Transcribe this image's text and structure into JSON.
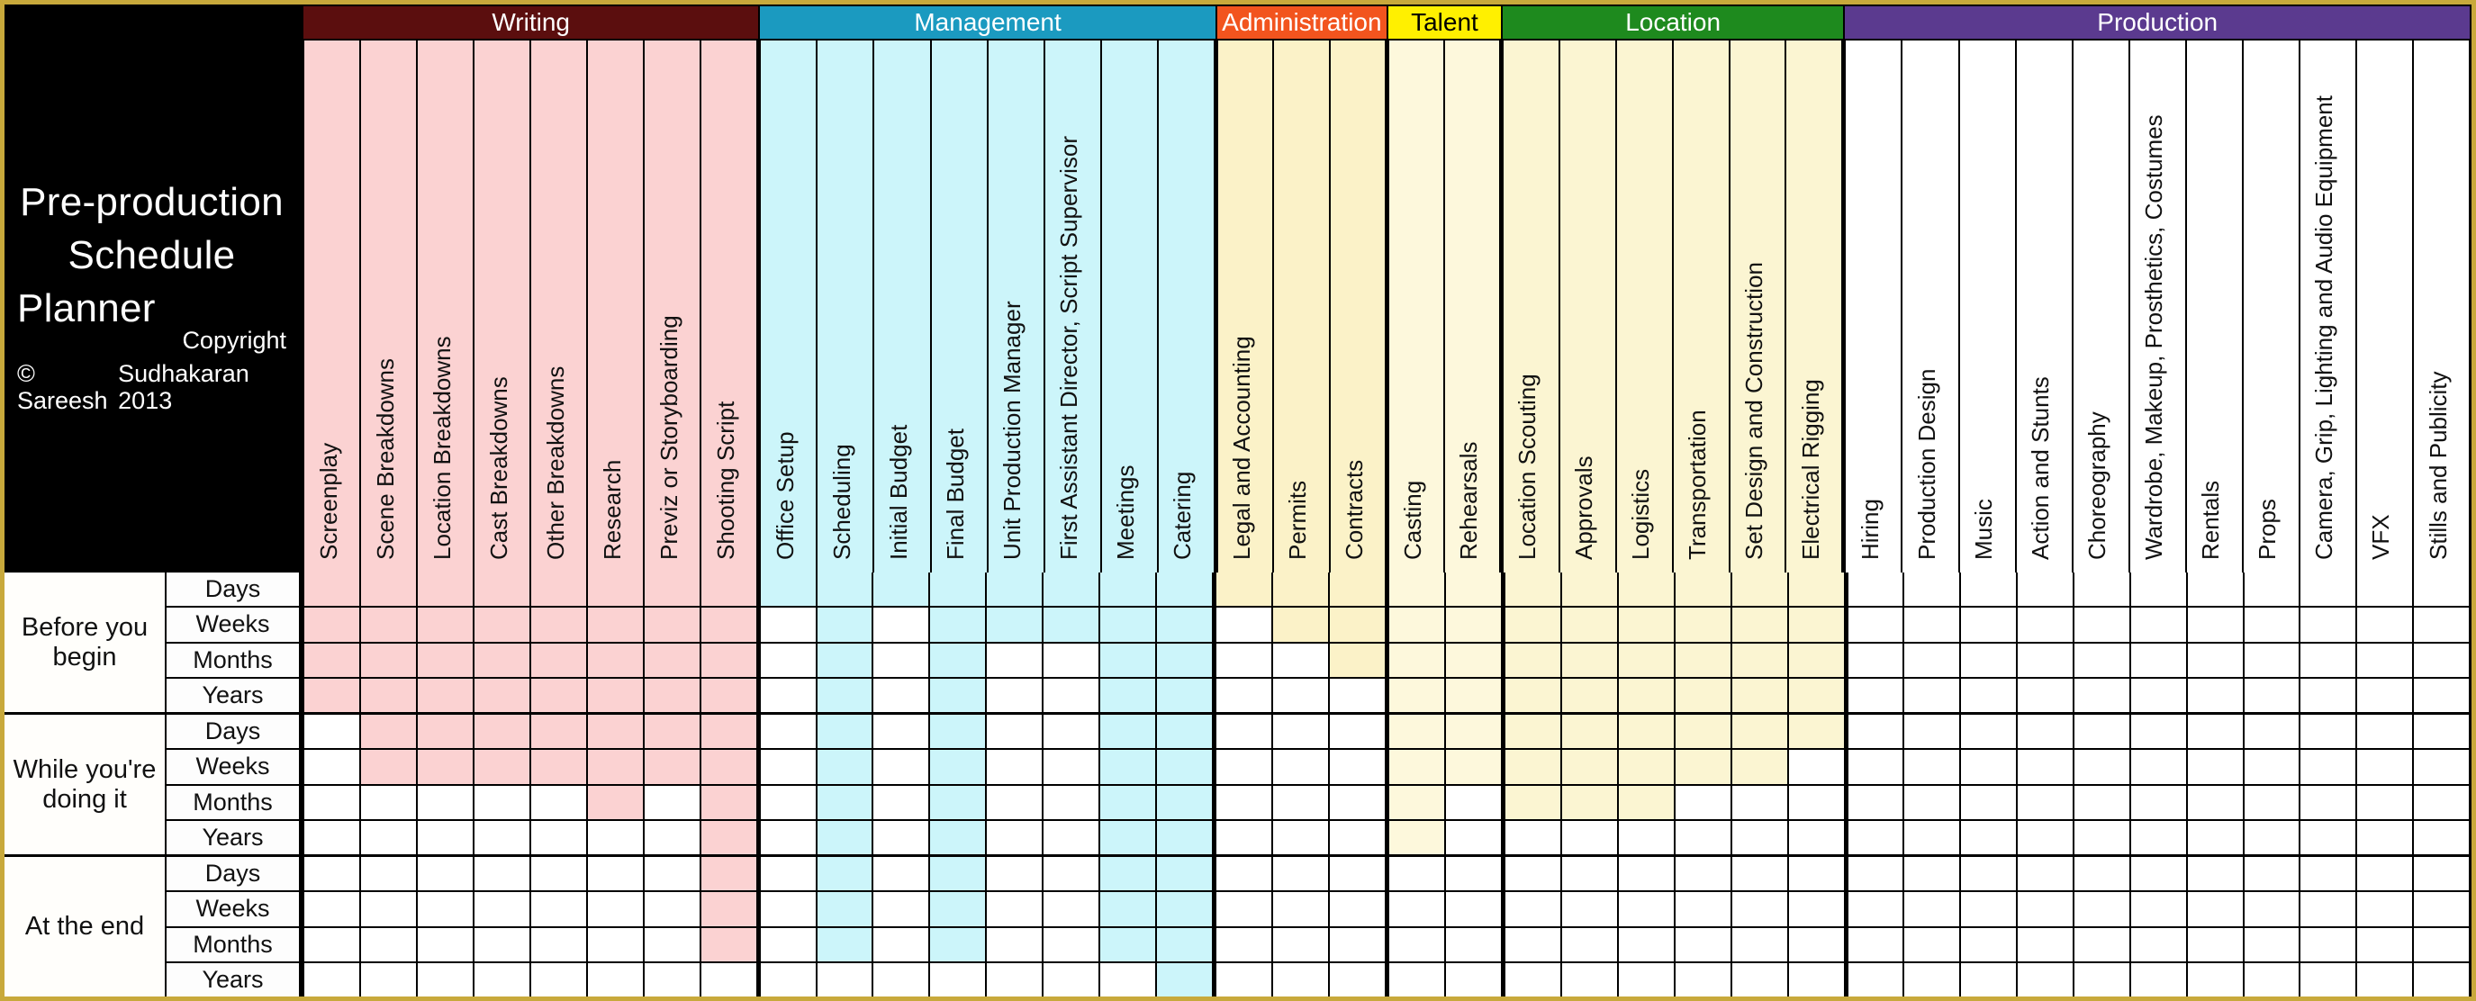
{
  "title": {
    "line1": "Pre-production",
    "line2": "Schedule",
    "line3": "Planner",
    "copyright_label": "Copyright",
    "copyright_owner": "© Sareesh",
    "copyright_rest": "Sudhakaran 2013"
  },
  "colors": {
    "sheet_border": "#C8A93B",
    "writing_header_bg": "#5B0E0E",
    "writing_header_fg": "#FFFFFF",
    "writing_cell": "#FBD2D2",
    "management_header_bg": "#1B9AC0",
    "management_header_fg": "#FFFFFF",
    "management_cell": "#CCF5FA",
    "administration_header_bg": "#F2541E",
    "administration_header_fg": "#FFFFFF",
    "administration_cell": "#FBF2C8",
    "talent_header_bg": "#FFF000",
    "talent_header_fg": "#000000",
    "talent_cell": "#FDF8DC",
    "location_header_bg": "#1E8A1E",
    "location_header_fg": "#FFFFFF",
    "location_cell": "#FBF5D2",
    "production_header_bg": "#5B3A8F",
    "production_header_fg": "#FFFFFF",
    "production_cell": "#FFFFFF",
    "empty_cell": "#FFFFFF",
    "title_bg": "#000000",
    "title_fg": "#FFFFFF"
  },
  "row_groups": [
    {
      "name": "Before you begin",
      "units": [
        "Days",
        "Weeks",
        "Months",
        "Years"
      ]
    },
    {
      "name": "While you're doing it",
      "units": [
        "Days",
        "Weeks",
        "Months",
        "Years"
      ]
    },
    {
      "name": "At the end",
      "units": [
        "Days",
        "Weeks",
        "Months",
        "Years"
      ]
    }
  ],
  "groups": [
    {
      "name": "Writing",
      "header_bg": "#5B0E0E",
      "header_fg": "#FFFFFF",
      "fill": "#FBD2D2",
      "columns": [
        "Screenplay",
        "Scene Breakdowns",
        "Location Breakdowns",
        "Cast Breakdowns",
        "Other Breakdowns",
        "Research",
        "Previz or Storyboarding",
        "Shooting Script"
      ],
      "matrix": [
        [
          1,
          1,
          1,
          1,
          1,
          1,
          1,
          1
        ],
        [
          1,
          1,
          1,
          1,
          1,
          1,
          1,
          1
        ],
        [
          1,
          1,
          1,
          1,
          1,
          1,
          1,
          1
        ],
        [
          1,
          1,
          1,
          1,
          1,
          1,
          1,
          1
        ],
        [
          0,
          1,
          1,
          1,
          1,
          1,
          1,
          1
        ],
        [
          0,
          1,
          1,
          1,
          1,
          1,
          1,
          1
        ],
        [
          0,
          0,
          0,
          0,
          0,
          1,
          0,
          1
        ],
        [
          0,
          0,
          0,
          0,
          0,
          0,
          0,
          1
        ],
        [
          0,
          0,
          0,
          0,
          0,
          0,
          0,
          1
        ],
        [
          0,
          0,
          0,
          0,
          0,
          0,
          0,
          1
        ],
        [
          0,
          0,
          0,
          0,
          0,
          0,
          0,
          1
        ],
        [
          0,
          0,
          0,
          0,
          0,
          0,
          0,
          0
        ]
      ]
    },
    {
      "name": "Management",
      "header_bg": "#1B9AC0",
      "header_fg": "#FFFFFF",
      "fill": "#CCF5FA",
      "columns": [
        "Office Setup",
        "Scheduling",
        "Initial Budget",
        "Final Budget",
        "Unit Production Manager",
        "First Assistant Director, Script Supervisor",
        "Meetings",
        "Catering"
      ],
      "matrix": [
        [
          1,
          1,
          1,
          1,
          1,
          1,
          1,
          1
        ],
        [
          0,
          1,
          0,
          1,
          1,
          1,
          1,
          1
        ],
        [
          0,
          1,
          0,
          1,
          0,
          0,
          1,
          1
        ],
        [
          0,
          1,
          0,
          1,
          0,
          0,
          1,
          1
        ],
        [
          0,
          1,
          0,
          1,
          0,
          0,
          1,
          1
        ],
        [
          0,
          1,
          0,
          1,
          0,
          0,
          1,
          1
        ],
        [
          0,
          1,
          0,
          1,
          0,
          0,
          1,
          1
        ],
        [
          0,
          1,
          0,
          1,
          0,
          0,
          1,
          1
        ],
        [
          0,
          1,
          0,
          1,
          0,
          0,
          1,
          1
        ],
        [
          0,
          1,
          0,
          1,
          0,
          0,
          1,
          1
        ],
        [
          0,
          1,
          0,
          1,
          0,
          0,
          1,
          1
        ],
        [
          0,
          0,
          0,
          0,
          0,
          0,
          0,
          1
        ]
      ]
    },
    {
      "name": "Administration",
      "header_bg": "#F2541E",
      "header_fg": "#FFFFFF",
      "fill": "#FBF2C8",
      "columns": [
        "Legal and Accounting",
        "Permits",
        "Contracts"
      ],
      "matrix": [
        [
          1,
          1,
          1
        ],
        [
          0,
          1,
          1
        ],
        [
          0,
          0,
          1
        ],
        [
          0,
          0,
          0
        ],
        [
          0,
          0,
          0
        ],
        [
          0,
          0,
          0
        ],
        [
          0,
          0,
          0
        ],
        [
          0,
          0,
          0
        ],
        [
          0,
          0,
          0
        ],
        [
          0,
          0,
          0
        ],
        [
          0,
          0,
          0
        ],
        [
          0,
          0,
          0
        ]
      ]
    },
    {
      "name": "Talent",
      "header_bg": "#FFF000",
      "header_fg": "#000000",
      "fill": "#FDF8DC",
      "columns": [
        "Casting",
        "Rehearsals"
      ],
      "matrix": [
        [
          1,
          1
        ],
        [
          1,
          1
        ],
        [
          1,
          1
        ],
        [
          1,
          1
        ],
        [
          1,
          1
        ],
        [
          1,
          1
        ],
        [
          1,
          0
        ],
        [
          1,
          0
        ],
        [
          0,
          0
        ],
        [
          0,
          0
        ],
        [
          0,
          0
        ],
        [
          0,
          0
        ]
      ]
    },
    {
      "name": "Location",
      "header_bg": "#1E8A1E",
      "header_fg": "#FFFFFF",
      "fill": "#FBF5D2",
      "columns": [
        "Location Scouting",
        "Approvals",
        "Logistics",
        "Transportation",
        "Set Design and Construction",
        "Electrical Rigging"
      ],
      "matrix": [
        [
          1,
          1,
          1,
          1,
          1,
          1
        ],
        [
          1,
          1,
          1,
          1,
          1,
          1
        ],
        [
          1,
          1,
          1,
          1,
          1,
          1
        ],
        [
          1,
          1,
          1,
          1,
          1,
          1
        ],
        [
          1,
          1,
          1,
          1,
          1,
          1
        ],
        [
          1,
          1,
          1,
          1,
          1,
          0
        ],
        [
          1,
          1,
          1,
          0,
          0,
          0
        ],
        [
          0,
          0,
          0,
          0,
          0,
          0
        ],
        [
          0,
          0,
          0,
          0,
          0,
          0
        ],
        [
          0,
          0,
          0,
          0,
          0,
          0
        ],
        [
          0,
          0,
          0,
          0,
          0,
          0
        ],
        [
          0,
          0,
          0,
          0,
          0,
          0
        ]
      ]
    },
    {
      "name": "Production",
      "header_bg": "#5B3A8F",
      "header_fg": "#FFFFFF",
      "fill": "#FFFFFF",
      "columns": [
        "Hiring",
        "Production Design",
        "Music",
        "Action and Stunts",
        "Choreography",
        "Wardrobe, Makeup, Prosthetics, Costumes",
        "Rentals",
        "Props",
        "Camera, Grip, Lighting and Audio Equipment",
        "VFX",
        "Stills and Publicity"
      ],
      "matrix": [
        [
          0,
          0,
          0,
          0,
          0,
          0,
          0,
          0,
          0,
          0,
          0
        ],
        [
          0,
          0,
          0,
          0,
          0,
          0,
          0,
          0,
          0,
          0,
          0
        ],
        [
          0,
          0,
          0,
          0,
          0,
          0,
          0,
          0,
          0,
          0,
          0
        ],
        [
          0,
          0,
          0,
          0,
          0,
          0,
          0,
          0,
          0,
          0,
          0
        ],
        [
          0,
          0,
          0,
          0,
          0,
          0,
          0,
          0,
          0,
          0,
          0
        ],
        [
          0,
          0,
          0,
          0,
          0,
          0,
          0,
          0,
          0,
          0,
          0
        ],
        [
          0,
          0,
          0,
          0,
          0,
          0,
          0,
          0,
          0,
          0,
          0
        ],
        [
          0,
          0,
          0,
          0,
          0,
          0,
          0,
          0,
          0,
          0,
          0
        ],
        [
          0,
          0,
          0,
          0,
          0,
          0,
          0,
          0,
          0,
          0,
          0
        ],
        [
          0,
          0,
          0,
          0,
          0,
          0,
          0,
          0,
          0,
          0,
          0
        ],
        [
          0,
          0,
          0,
          0,
          0,
          0,
          0,
          0,
          0,
          0,
          0
        ],
        [
          0,
          0,
          0,
          0,
          0,
          0,
          0,
          0,
          0,
          0,
          0
        ]
      ]
    }
  ]
}
